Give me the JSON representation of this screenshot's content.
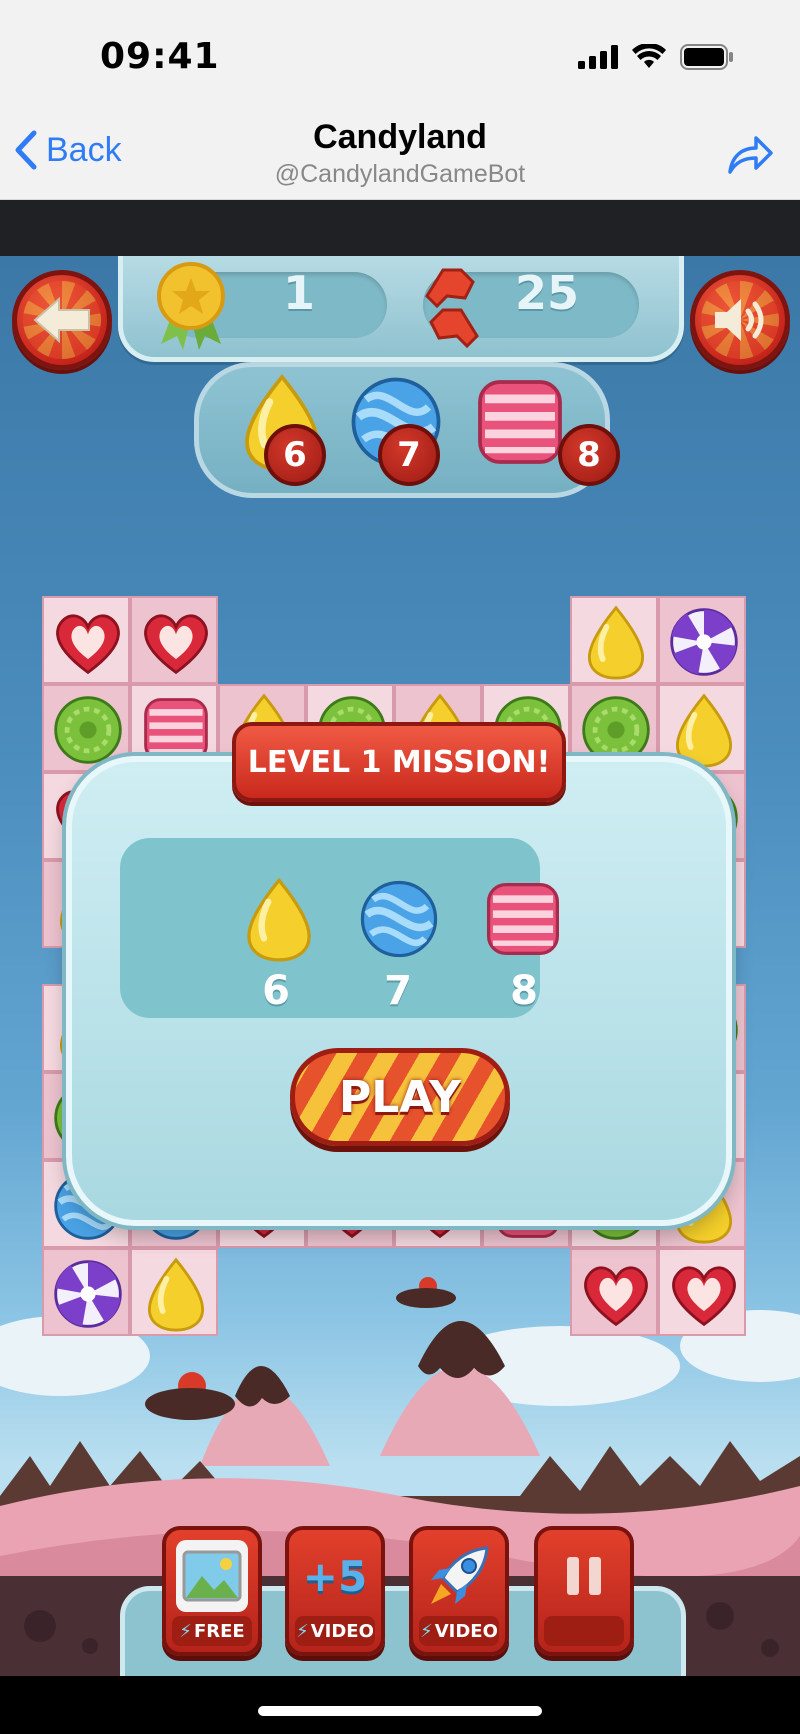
{
  "status_bar": {
    "time": "09:41",
    "icons": [
      "cellular-signal-icon",
      "wifi-icon",
      "battery-icon"
    ]
  },
  "nav": {
    "back_label": "Back",
    "title": "Candyland",
    "subtitle": "@CandylandGameBot",
    "share_icon": "share-arrow-icon"
  },
  "hud": {
    "level": "1",
    "moves": "25",
    "targets": [
      {
        "candy": "yellow-drop",
        "count": "6"
      },
      {
        "candy": "blue-swirl-ball",
        "count": "7"
      },
      {
        "candy": "pink-striped-cube",
        "count": "8"
      }
    ]
  },
  "mission": {
    "title": "LEVEL 1 MISSION!",
    "goals": [
      {
        "candy": "yellow-drop",
        "count": "6"
      },
      {
        "candy": "blue-swirl-ball",
        "count": "7"
      },
      {
        "candy": "pink-striped-cube",
        "count": "8"
      }
    ],
    "play_label": "PLAY"
  },
  "boosters": [
    {
      "name": "picture",
      "tag": "FREE"
    },
    {
      "name": "+5",
      "tag": "VIDEO"
    },
    {
      "name": "rocket",
      "tag": "VIDEO"
    },
    {
      "name": "pause",
      "tag": ""
    }
  ],
  "colors": {
    "accent_red": "#c9291d",
    "panel_teal": "#a9d8e1",
    "ios_blue": "#2f7cf6"
  }
}
